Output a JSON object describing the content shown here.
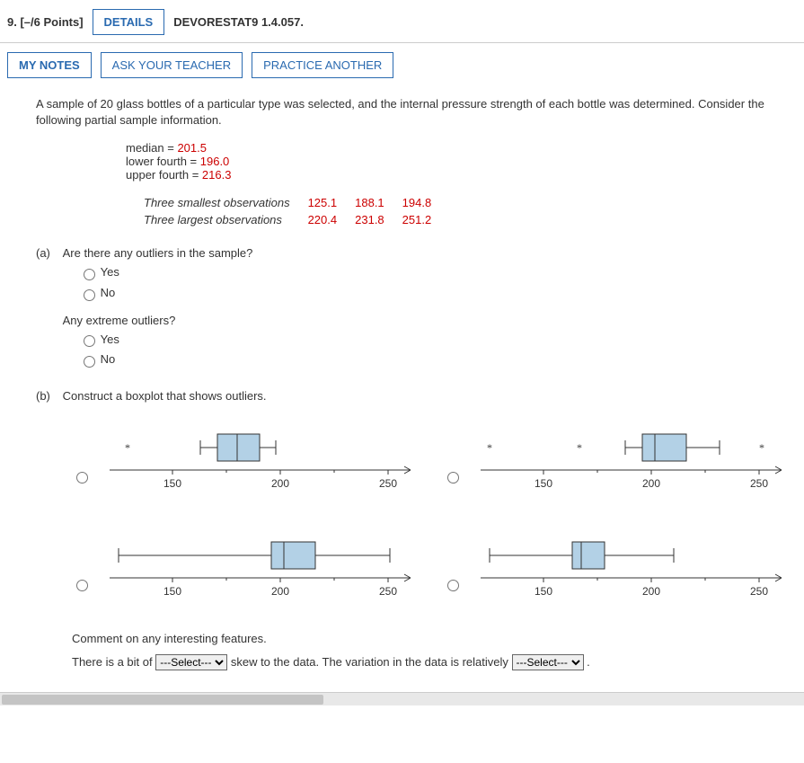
{
  "header": {
    "number": "9.",
    "points": "[–/6 Points]",
    "details": "DETAILS",
    "ref": "DEVORESTAT9 1.4.057."
  },
  "row2": {
    "notes": "MY NOTES",
    "ask": "ASK YOUR TEACHER",
    "practice": "PRACTICE ANOTHER"
  },
  "problem": "A sample of 20 glass bottles of a particular type was selected, and the internal pressure strength of each bottle was determined. Consider the following partial sample information.",
  "stats": {
    "median_label": "median = ",
    "median_val": "201.5",
    "lower_label": "lower fourth = ",
    "lower_val": "196.0",
    "upper_label": "upper fourth = ",
    "upper_val": "216.3"
  },
  "obs": {
    "small_label": "Three smallest observations",
    "small_vals": [
      "125.1",
      "188.1",
      "194.8"
    ],
    "large_label": "Three largest observations",
    "large_vals": [
      "220.4",
      "231.8",
      "251.2"
    ]
  },
  "partA": {
    "label": "(a)",
    "q1": "Are there any outliers in the sample?",
    "yes": "Yes",
    "no": "No",
    "q2": "Any extreme outliers?"
  },
  "partB": {
    "label": "(b)",
    "q": "Construct a boxplot that shows outliers.",
    "ticks": [
      "150",
      "200",
      "250"
    ]
  },
  "comment": {
    "lead": "Comment on any interesting features.",
    "t1": "There is a bit of ",
    "t2": " skew to the data. The variation in the data is relatively ",
    "t3": ".",
    "select_default": "---Select---"
  }
}
